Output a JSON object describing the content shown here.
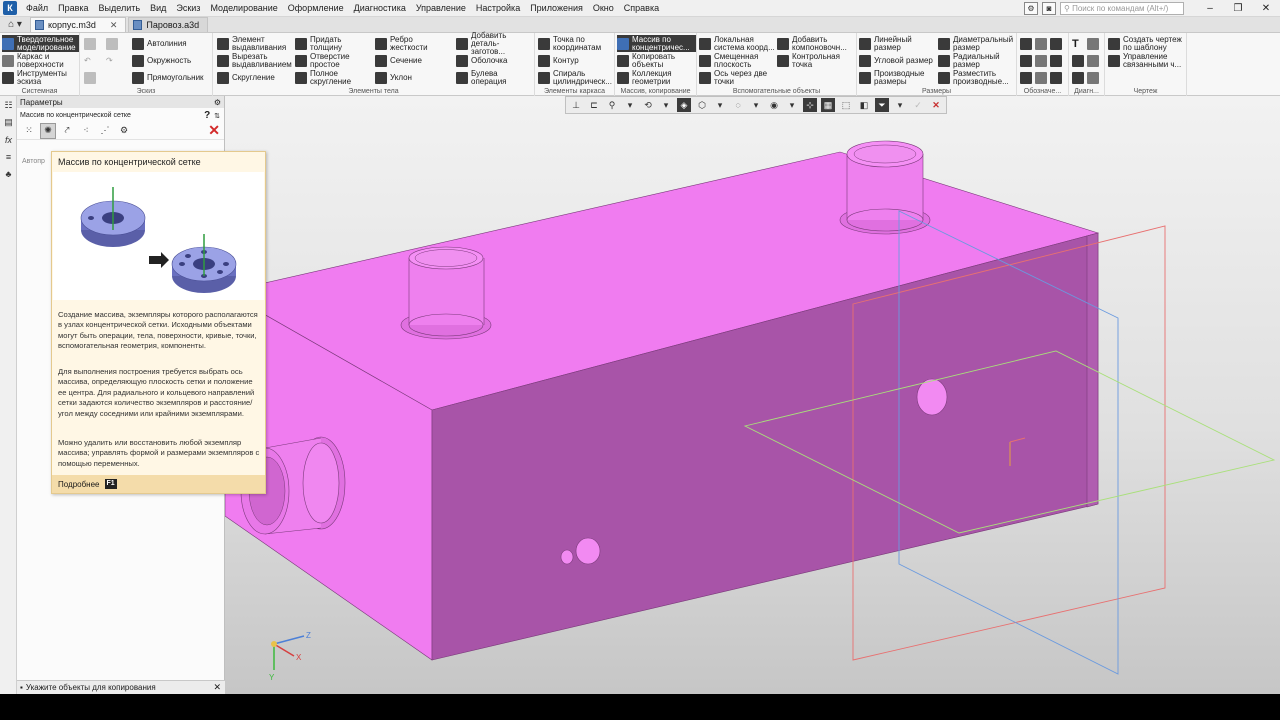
{
  "menu": {
    "logo": "К",
    "items": [
      "Файл",
      "Правка",
      "Выделить",
      "Вид",
      "Эскиз",
      "Моделирование",
      "Оформление",
      "Диагностика",
      "Управление",
      "Настройка",
      "Приложения",
      "Окно",
      "Справка"
    ],
    "search_placeholder": "Поиск по командам (Alt+/)"
  },
  "tabs": [
    {
      "label": "корпус.m3d",
      "active": true
    },
    {
      "label": "Паровоз.a3d",
      "active": false
    }
  ],
  "ribbon": {
    "groups": [
      {
        "label": "Системная",
        "items": [
          "Твердотельное моделирование",
          "Каркас и поверхности",
          "Инструменты эскиза"
        ]
      },
      {
        "label": "Эскиз",
        "items": [
          "Автолиния",
          "Окружность",
          "Прямоугольник"
        ]
      },
      {
        "label": "Элементы тела",
        "items": [
          "Элемент выдавливания",
          "Вырезать выдавливанием",
          "Скругление",
          "Придать толщину",
          "Отверстие простое",
          "Полное скругление",
          "Ребро жесткости",
          "Сечение",
          "Уклон",
          "Добавить деталь-заготов...",
          "Оболочка",
          "Булева операция"
        ]
      },
      {
        "label": "Элементы каркаса",
        "items": [
          "Точка по координатам",
          "Контур",
          "Спираль цилиндрическ..."
        ]
      },
      {
        "label": "Массив, копирование",
        "items": [
          "Массив по концентричес...",
          "Копировать объекты",
          "Коллекция геометрии"
        ]
      },
      {
        "label": "Вспомогательные объекты",
        "items": [
          "Локальная система коорд...",
          "Смещенная плоскость",
          "Ось через две точки",
          "Добавить компоновочн...",
          "Контрольная точка"
        ]
      },
      {
        "label": "Размеры",
        "items": [
          "Линейный размер",
          "Угловой размер",
          "Производные размеры",
          "Диаметральный размер",
          "Радиальный размер",
          "Разместить производные..."
        ]
      },
      {
        "label": "Обозначе...",
        "items": []
      },
      {
        "label": "Диагн...",
        "items": []
      },
      {
        "label": "Чертеж",
        "items": [
          "Создать чертеж по шаблону",
          "Управление связанными ч..."
        ]
      }
    ]
  },
  "params": {
    "title": "Параметры",
    "subtitle": "Массив по концентрической сетке",
    "auto_label": "Автопр",
    "status": "Укажите объекты для копирования"
  },
  "tooltip": {
    "title": "Массив по концентрической сетке",
    "paragraphs": [
      "Создание массива, экземпляры которого располагаются в узлах концентрической сетки. Исходными объектами могут быть операции, тела, поверхности, кривые, точки, вспомогательная геометрия, компоненты.",
      "Для выполнения построения требуется выбрать ось массива, определяющую плоскость сетки и положение ее центра. Для радиального и кольцевого направлений сетки задаются количество экземпляров и расстояние/угол между соседними или крайними экземплярами.",
      "Можно удалить или восстановить любой экземпляр массива; управлять формой и размерами экземпляров с помощью переменных."
    ],
    "more": "Подробнее",
    "key": "F1"
  },
  "axes": {
    "x": "X",
    "y": "Y",
    "z": "Z"
  },
  "colors": {
    "model_top": "#f07cf0",
    "model_front": "#c25ec2",
    "model_side": "#a04fa0",
    "plane_red": "#e87070",
    "plane_blue": "#6a9adf",
    "plane_green": "#a9e07a"
  }
}
